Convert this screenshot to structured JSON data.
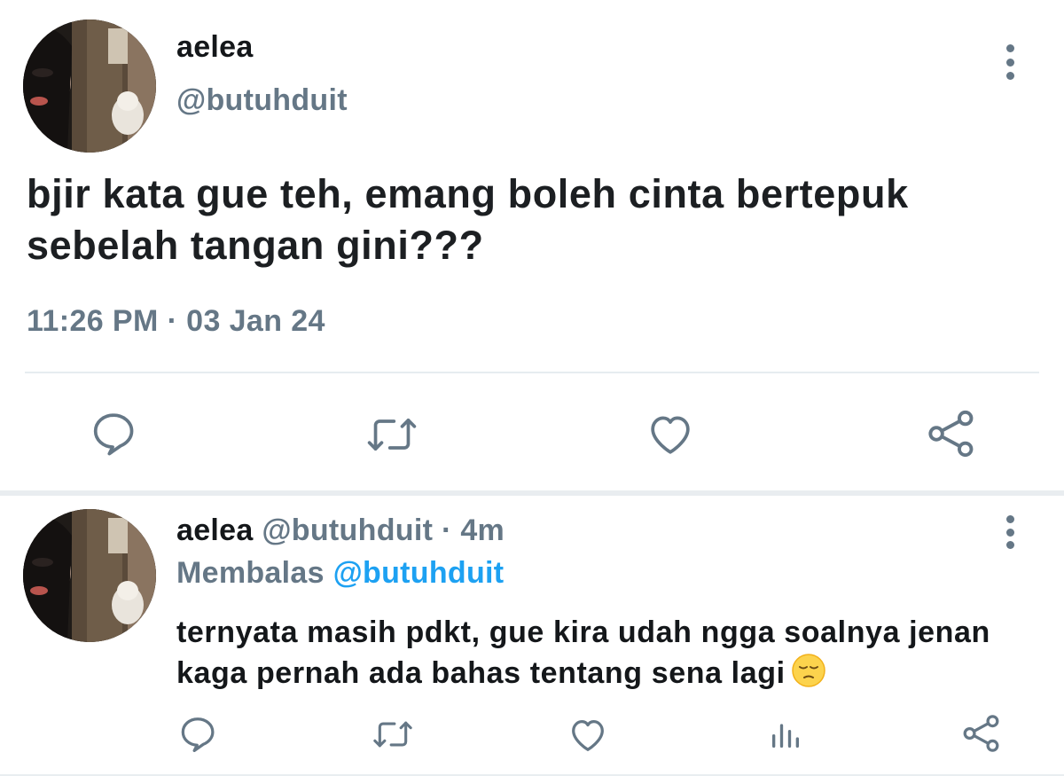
{
  "tweet": {
    "author_name": "aelea",
    "author_handle": "@butuhduit",
    "text": "bjir kata gue teh, emang boleh cinta bertepuk sebelah tangan gini???",
    "timestamp": "11:26 PM · 03 Jan 24",
    "actions": [
      "reply-icon",
      "retweet-icon",
      "like-icon",
      "share-icon"
    ]
  },
  "reply": {
    "author_name": "aelea",
    "author_handle": "@butuhduit",
    "separator": "·",
    "time_ago": "4m",
    "replying_label": "Membalas",
    "replying_to": "@butuhduit",
    "text": "ternyata masih pdkt, gue kira udah ngga soalnya jenan kaga pernah ada bahas tentang sena lagi",
    "emoji": "pensive-face",
    "actions": [
      "reply-icon",
      "retweet-icon",
      "like-icon",
      "analytics-icon",
      "share-icon"
    ]
  },
  "colors": {
    "text_primary": "#14171a",
    "text_secondary": "#657786",
    "link": "#1da1f2",
    "icon": "#657786",
    "divider": "#e6ecf0"
  }
}
